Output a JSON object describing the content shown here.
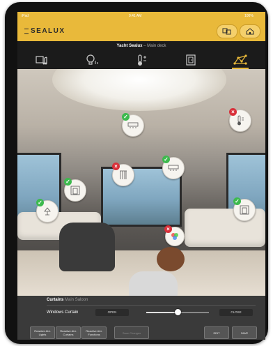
{
  "status": {
    "left": "iPad",
    "time": "9:41 AM",
    "battery": "100%"
  },
  "header": {
    "brand": "SEALUX",
    "btn_scenes_icon": "scenes-icon",
    "btn_home_icon": "home-icon"
  },
  "subtitle": {
    "yacht": "Yacht Sealux",
    "separator": " – ",
    "deck": "Main deck"
  },
  "tabs": [
    {
      "icon": "media-icon"
    },
    {
      "icon": "lighting-icon"
    },
    {
      "icon": "temperature-icon"
    },
    {
      "icon": "door-icon"
    },
    {
      "icon": "network-icon",
      "active": true
    }
  ],
  "hotspots": [
    {
      "name": "hotspot-ceiling-vent",
      "icon": "vent-icon",
      "status": "ok"
    },
    {
      "name": "hotspot-thermostat",
      "icon": "thermometer-icon",
      "status": "error"
    },
    {
      "name": "hotspot-curtain-left-mid",
      "icon": "curtain-icon",
      "status": "error"
    },
    {
      "name": "hotspot-ceiling-vent-2",
      "icon": "vent-icon",
      "status": "ok"
    },
    {
      "name": "hotspot-window-curtain-left",
      "icon": "window-icon",
      "status": "ok"
    },
    {
      "name": "hotspot-lamp-left",
      "icon": "lamp-icon",
      "status": "ok"
    },
    {
      "name": "hotspot-window-curtain-right",
      "icon": "window-icon",
      "status": "ok"
    },
    {
      "name": "hotspot-color-light",
      "icon": "rgb-light-icon",
      "status": "error"
    }
  ],
  "panel": {
    "title": "Curtains",
    "location": "Main Saloon",
    "control_label": "Windows Curtain",
    "open_label": "OPEN",
    "close_label": "CLOSE",
    "slider_value": 0.5
  },
  "buttons": {
    "reactivate_lights": "Reactive ALL Lights",
    "reactivate_curtains": "Reactive ALL Curtains",
    "reactivate_functions": "Reactive ALL Functions",
    "save_changes": "Save Changes",
    "edit": "EDIT",
    "save": "SAVE"
  },
  "colors": {
    "accent": "#e9b93a",
    "ok": "#3dba4e",
    "error": "#d9303a"
  }
}
